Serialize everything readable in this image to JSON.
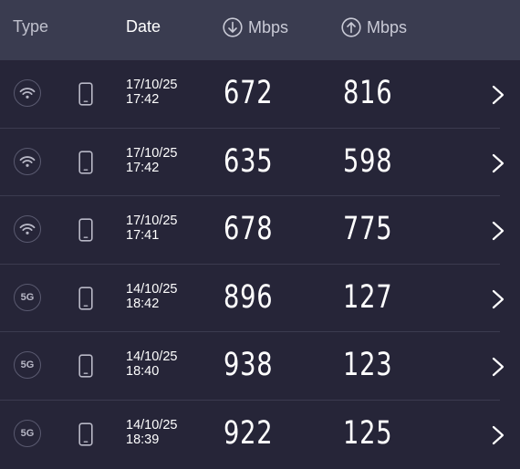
{
  "header": {
    "type_label": "Type",
    "date_label": "Date",
    "download_label": "Mbps",
    "upload_label": "Mbps",
    "download_icon": "arrow-down-circle-icon",
    "upload_icon": "arrow-up-circle-icon"
  },
  "rows": [
    {
      "type": "wifi",
      "type_label": "",
      "device": "phone-icon",
      "date": "17/10/25",
      "time": "17:42",
      "download": "672",
      "upload": "816"
    },
    {
      "type": "wifi",
      "type_label": "",
      "device": "phone-icon",
      "date": "17/10/25",
      "time": "17:42",
      "download": "635",
      "upload": "598"
    },
    {
      "type": "wifi",
      "type_label": "",
      "device": "phone-icon",
      "date": "17/10/25",
      "time": "17:41",
      "download": "678",
      "upload": "775"
    },
    {
      "type": "5g",
      "type_label": "5G",
      "device": "phone-icon",
      "date": "14/10/25",
      "time": "18:42",
      "download": "896",
      "upload": "127"
    },
    {
      "type": "5g",
      "type_label": "5G",
      "device": "phone-icon",
      "date": "14/10/25",
      "time": "18:40",
      "download": "938",
      "upload": "123"
    },
    {
      "type": "5g",
      "type_label": "5G",
      "device": "phone-icon",
      "date": "14/10/25",
      "time": "18:39",
      "download": "922",
      "upload": "125"
    }
  ],
  "colors": {
    "background": "#262538",
    "header": "#3a3c50",
    "divider": "#3b3b4f"
  }
}
